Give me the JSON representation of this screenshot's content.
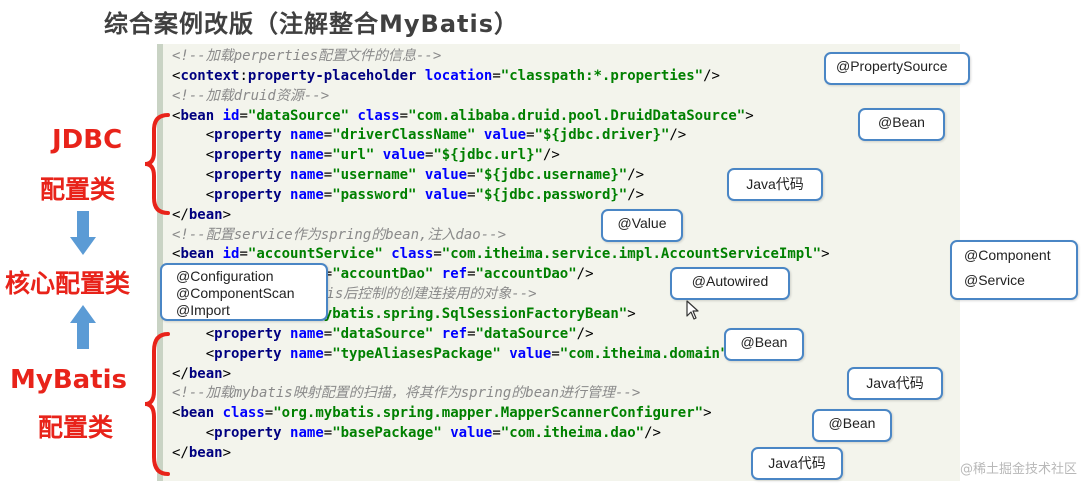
{
  "title": "综合案例改版（注解整合MyBatis）",
  "code_lines": [
    [
      {
        "t": "cm",
        "v": "<!--加载perperties配置文件的信息-->"
      }
    ],
    [
      {
        "t": "tx",
        "v": "<"
      },
      {
        "t": "tg",
        "v": "context"
      },
      {
        "t": "tx",
        "v": ":"
      },
      {
        "t": "tg",
        "v": "property-placeholder"
      },
      {
        "t": "tx",
        "v": " "
      },
      {
        "t": "at",
        "v": "location"
      },
      {
        "t": "tx",
        "v": "="
      },
      {
        "t": "vl",
        "v": "\"classpath:*.properties\""
      },
      {
        "t": "tx",
        "v": "/>"
      }
    ],
    [
      {
        "t": "cm",
        "v": "<!--加载druid资源-->"
      }
    ],
    [
      {
        "t": "tx",
        "v": "<"
      },
      {
        "t": "tg",
        "v": "bean"
      },
      {
        "t": "tx",
        "v": " "
      },
      {
        "t": "at",
        "v": "id"
      },
      {
        "t": "tx",
        "v": "="
      },
      {
        "t": "vl",
        "v": "\"dataSource\""
      },
      {
        "t": "tx",
        "v": " "
      },
      {
        "t": "at",
        "v": "class"
      },
      {
        "t": "tx",
        "v": "="
      },
      {
        "t": "vl",
        "v": "\"com.alibaba.druid.pool.DruidDataSource\""
      },
      {
        "t": "tx",
        "v": ">"
      }
    ],
    [
      {
        "t": "tx",
        "v": "    <"
      },
      {
        "t": "tg",
        "v": "property"
      },
      {
        "t": "tx",
        "v": " "
      },
      {
        "t": "at",
        "v": "name"
      },
      {
        "t": "tx",
        "v": "="
      },
      {
        "t": "vl",
        "v": "\"driverClassName\""
      },
      {
        "t": "tx",
        "v": " "
      },
      {
        "t": "at",
        "v": "value"
      },
      {
        "t": "tx",
        "v": "="
      },
      {
        "t": "vl",
        "v": "\"${jdbc.driver}\""
      },
      {
        "t": "tx",
        "v": "/>"
      }
    ],
    [
      {
        "t": "tx",
        "v": "    <"
      },
      {
        "t": "tg",
        "v": "property"
      },
      {
        "t": "tx",
        "v": " "
      },
      {
        "t": "at",
        "v": "name"
      },
      {
        "t": "tx",
        "v": "="
      },
      {
        "t": "vl",
        "v": "\"url\""
      },
      {
        "t": "tx",
        "v": " "
      },
      {
        "t": "at",
        "v": "value"
      },
      {
        "t": "tx",
        "v": "="
      },
      {
        "t": "vl",
        "v": "\"${jdbc.url}\""
      },
      {
        "t": "tx",
        "v": "/>"
      }
    ],
    [
      {
        "t": "tx",
        "v": "    <"
      },
      {
        "t": "tg",
        "v": "property"
      },
      {
        "t": "tx",
        "v": " "
      },
      {
        "t": "at",
        "v": "name"
      },
      {
        "t": "tx",
        "v": "="
      },
      {
        "t": "vl",
        "v": "\"username\""
      },
      {
        "t": "tx",
        "v": " "
      },
      {
        "t": "at",
        "v": "value"
      },
      {
        "t": "tx",
        "v": "="
      },
      {
        "t": "vl",
        "v": "\"${jdbc.username}\""
      },
      {
        "t": "tx",
        "v": "/>"
      }
    ],
    [
      {
        "t": "tx",
        "v": "    <"
      },
      {
        "t": "tg",
        "v": "property"
      },
      {
        "t": "tx",
        "v": " "
      },
      {
        "t": "at",
        "v": "name"
      },
      {
        "t": "tx",
        "v": "="
      },
      {
        "t": "vl",
        "v": "\"password\""
      },
      {
        "t": "tx",
        "v": " "
      },
      {
        "t": "at",
        "v": "value"
      },
      {
        "t": "tx",
        "v": "="
      },
      {
        "t": "vl",
        "v": "\"${jdbc.password}\""
      },
      {
        "t": "tx",
        "v": "/>"
      }
    ],
    [
      {
        "t": "tx",
        "v": "</"
      },
      {
        "t": "tg",
        "v": "bean"
      },
      {
        "t": "tx",
        "v": ">"
      }
    ],
    [
      {
        "t": "cm",
        "v": "<!--配置service作为spring的bean,注入dao-->"
      }
    ],
    [
      {
        "t": "tx",
        "v": "<"
      },
      {
        "t": "tg",
        "v": "bean"
      },
      {
        "t": "tx",
        "v": " "
      },
      {
        "t": "at",
        "v": "id"
      },
      {
        "t": "tx",
        "v": "="
      },
      {
        "t": "vl",
        "v": "\"accountService\""
      },
      {
        "t": "tx",
        "v": " "
      },
      {
        "t": "at",
        "v": "class"
      },
      {
        "t": "tx",
        "v": "="
      },
      {
        "t": "vl",
        "v": "\"com.itheima.service.impl.AccountServiceImpl\""
      },
      {
        "t": "tx",
        "v": ">"
      }
    ],
    [
      {
        "t": "tx",
        "v": "    <"
      },
      {
        "t": "tg",
        "v": "property"
      },
      {
        "t": "tx",
        "v": " "
      },
      {
        "t": "at",
        "v": "name"
      },
      {
        "t": "tx",
        "v": "="
      },
      {
        "t": "vl",
        "v": "\"accountDao\""
      },
      {
        "t": "tx",
        "v": " "
      },
      {
        "t": "at",
        "v": "ref"
      },
      {
        "t": "tx",
        "v": "="
      },
      {
        "t": "vl",
        "v": "\"accountDao\""
      },
      {
        "t": "tx",
        "v": "/>"
      }
    ],
    [
      {
        "t": "cm",
        "v": "<!--spring整合mybatis后控制的创建连接用的对象-->"
      }
    ],
    [
      {
        "t": "tx",
        "v": "<"
      },
      {
        "t": "tg",
        "v": "bean"
      },
      {
        "t": "tx",
        "v": " "
      },
      {
        "t": "at",
        "v": "class"
      },
      {
        "t": "tx",
        "v": "="
      },
      {
        "t": "vl",
        "v": "\"org.mybatis.spring.SqlSessionFactoryBean\""
      },
      {
        "t": "tx",
        "v": ">"
      }
    ],
    [
      {
        "t": "tx",
        "v": "    <"
      },
      {
        "t": "tg",
        "v": "property"
      },
      {
        "t": "tx",
        "v": " "
      },
      {
        "t": "at",
        "v": "name"
      },
      {
        "t": "tx",
        "v": "="
      },
      {
        "t": "vl",
        "v": "\"dataSource\""
      },
      {
        "t": "tx",
        "v": " "
      },
      {
        "t": "at",
        "v": "ref"
      },
      {
        "t": "tx",
        "v": "="
      },
      {
        "t": "vl",
        "v": "\"dataSource\""
      },
      {
        "t": "tx",
        "v": "/>"
      }
    ],
    [
      {
        "t": "tx",
        "v": "    <"
      },
      {
        "t": "tg",
        "v": "property"
      },
      {
        "t": "tx",
        "v": " "
      },
      {
        "t": "at",
        "v": "name"
      },
      {
        "t": "tx",
        "v": "="
      },
      {
        "t": "vl",
        "v": "\"typeAliasesPackage\""
      },
      {
        "t": "tx",
        "v": " "
      },
      {
        "t": "at",
        "v": "value"
      },
      {
        "t": "tx",
        "v": "="
      },
      {
        "t": "vl",
        "v": "\"com.itheima.domain\""
      },
      {
        "t": "tx",
        "v": "/>"
      }
    ],
    [
      {
        "t": "tx",
        "v": "</"
      },
      {
        "t": "tg",
        "v": "bean"
      },
      {
        "t": "tx",
        "v": ">"
      }
    ],
    [
      {
        "t": "cm",
        "v": "<!--加载mybatis映射配置的扫描，将其作为spring的bean进行管理-->"
      }
    ],
    [
      {
        "t": "tx",
        "v": "<"
      },
      {
        "t": "tg",
        "v": "bean"
      },
      {
        "t": "tx",
        "v": " "
      },
      {
        "t": "at",
        "v": "class"
      },
      {
        "t": "tx",
        "v": "="
      },
      {
        "t": "vl",
        "v": "\"org.mybatis.spring.mapper.MapperScannerConfigurer\""
      },
      {
        "t": "tx",
        "v": ">"
      }
    ],
    [
      {
        "t": "tx",
        "v": "    <"
      },
      {
        "t": "tg",
        "v": "property"
      },
      {
        "t": "tx",
        "v": " "
      },
      {
        "t": "at",
        "v": "name"
      },
      {
        "t": "tx",
        "v": "="
      },
      {
        "t": "vl",
        "v": "\"basePackage\""
      },
      {
        "t": "tx",
        "v": " "
      },
      {
        "t": "at",
        "v": "value"
      },
      {
        "t": "tx",
        "v": "="
      },
      {
        "t": "vl",
        "v": "\"com.itheima.dao\""
      },
      {
        "t": "tx",
        "v": "/>"
      }
    ],
    [
      {
        "t": "tx",
        "v": "</"
      },
      {
        "t": "tg",
        "v": "bean"
      },
      {
        "t": "tx",
        "v": ">"
      }
    ]
  ],
  "callouts": {
    "property_source": "@PropertySource",
    "bean_1": "@Bean",
    "java_code_1": "Java代码",
    "value": "@Value",
    "component": "@Component",
    "service": "@Service",
    "autowired": "@Autowired",
    "configuration": "@Configuration",
    "component_scan": "@ComponentScan",
    "import": "@Import",
    "bean_2": "@Bean",
    "java_code_2": "Java代码",
    "bean_3": "@Bean",
    "java_code_3": "Java代码"
  },
  "side": {
    "jdbc": "JDBC",
    "jdbc_sub": "配置类",
    "core": "核心配置类",
    "mybatis": "MyBatis",
    "mybatis_sub": "配置类"
  },
  "colors": {
    "accent_red": "#e8231a",
    "callout_border": "#4a86c5",
    "arrow_blue": "#5b9bd5",
    "code_bg": "#f3f4ec"
  },
  "watermark": "@稀土掘金技术社区"
}
